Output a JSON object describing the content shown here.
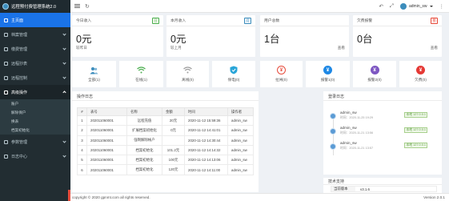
{
  "app": {
    "title": "远程预付费管理系统2.0"
  },
  "sidebar": {
    "items": [
      {
        "label": "主页面",
        "active": true
      },
      {
        "label": "档案管理"
      },
      {
        "label": "缴费管理"
      },
      {
        "label": "远程抄表"
      },
      {
        "label": "远程控制"
      },
      {
        "label": "高级操作",
        "open": true
      },
      {
        "label": "参数管理"
      },
      {
        "label": "日志中心"
      }
    ],
    "subitems": [
      "账户",
      "解除保户",
      "换表",
      "档案初始化"
    ]
  },
  "topbar": {
    "username": "admin_sw"
  },
  "stats": [
    {
      "title": "今日收入",
      "badge": "日",
      "badge_color": "#4caf50",
      "value": "0元",
      "sub": "较昨日",
      "sub_right": ""
    },
    {
      "title": "本月收入",
      "badge": "月",
      "badge_color": "#3c8dbc",
      "value": "0元",
      "sub": "较上月",
      "sub_right": ""
    },
    {
      "title": "用户总数",
      "badge": "",
      "badge_color": "",
      "value": "1台",
      "sub": "",
      "sub_right": "查看"
    },
    {
      "title": "欠费报警",
      "badge": "警",
      "badge_color": "#e74c3c",
      "value": "0台",
      "sub": "",
      "sub_right": "查看"
    }
  ],
  "quick": [
    {
      "label": "全部(1)",
      "icon": "users-icon",
      "color": "#3c8dbc"
    },
    {
      "label": "在线(1)",
      "icon": "wifi-icon",
      "color": "#4caf50"
    },
    {
      "label": "离线(0)",
      "icon": "wifi-off-icon",
      "color": "#9e9e9e"
    },
    {
      "label": "保电(0)",
      "icon": "shield-icon",
      "color": "#29a5d8"
    },
    {
      "label": "拉闸(0)",
      "icon": "power-off-icon",
      "color": "#e74c3c"
    },
    {
      "label": "报警1(0)",
      "icon": "yen-alert-1-icon",
      "color": "#1e88e5"
    },
    {
      "label": "报警2(0)",
      "icon": "yen-alert-2-icon",
      "color": "#7e57c2"
    },
    {
      "label": "欠费(0)",
      "icon": "yen-arrears-icon",
      "color": "#e53935"
    }
  ],
  "ops_log": {
    "title": "操作日志",
    "columns": [
      "#",
      "表号",
      "名称",
      "金额",
      "时间",
      "操作者"
    ],
    "rows": [
      [
        "1",
        "202011060001",
        "远程充值",
        "20元",
        "2020-11-12 15:59:36",
        "admin_sw"
      ],
      [
        "2",
        "202011060001",
        "扩展档案初始化",
        "0元",
        "2020-11-12 14:41:01",
        "admin_sw"
      ],
      [
        "3",
        "202011060001",
        "强制解除帐户",
        "",
        "2020-11-12 14:30:44",
        "admin_sw"
      ],
      [
        "4",
        "202011060001",
        "档案初始化",
        "101.2元",
        "2020-11-12 14:14:32",
        "admin_sw"
      ],
      [
        "5",
        "202011060001",
        "档案初始化",
        "100元",
        "2020-11-12 14:13:06",
        "admin_sw"
      ],
      [
        "6",
        "202011060001",
        "档案初始化",
        "120元",
        "2020-11-12 14:11:00",
        "admin_sw"
      ]
    ]
  },
  "login_log": {
    "title": "登录日志",
    "entries": [
      {
        "name": "admin_sw",
        "time": "时间：2020-11-25 19:29",
        "ip": "本地 127.0.0.1"
      },
      {
        "name": "admin_sw",
        "time": "时间：2020-11-21 13:56",
        "ip": "本地 127.0.0.1"
      },
      {
        "name": "admin_sw",
        "time": "时间：2020-11-21 13:57",
        "ip": "本地 127.0.0.1"
      }
    ]
  },
  "tech": {
    "title": "技术支持",
    "version_label": "当前版本",
    "version_value": "v3.1.6"
  },
  "footer": {
    "copyright": "copyright © 2020 gpnmt.com all rights reserved.",
    "version": "Version 2.0.1"
  }
}
